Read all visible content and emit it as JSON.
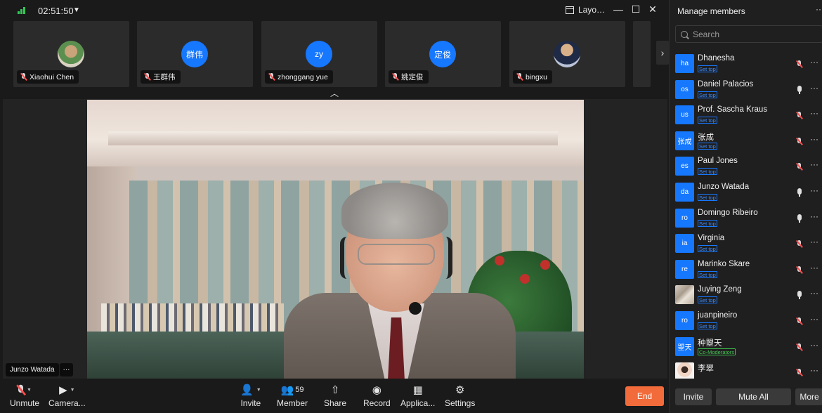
{
  "topbar": {
    "timer": "02:51:50",
    "layout_label": "Layo…",
    "colors": {
      "signal": "#35c759"
    }
  },
  "thumbnails": [
    {
      "name": "Xiaohui Chen",
      "avatar_text": "",
      "avatar_kind": "photo"
    },
    {
      "name": "王群伟",
      "avatar_text": "群伟",
      "avatar_kind": "initials"
    },
    {
      "name": "zhonggang yue",
      "avatar_text": "zy",
      "avatar_kind": "initials"
    },
    {
      "name": "姚定俊",
      "avatar_text": "定俊",
      "avatar_kind": "initials"
    },
    {
      "name": "bingxu",
      "avatar_text": "",
      "avatar_kind": "photo"
    }
  ],
  "main_video": {
    "speaker_name": "Junzo Watada",
    "more_label": "···"
  },
  "toolbar": {
    "unmute_label": "Unmute",
    "camera_label": "Camera...",
    "invite_label": "Invite",
    "member_label": "Member",
    "member_count": "59",
    "share_label": "Share",
    "record_label": "Record",
    "apps_label": "Applica...",
    "settings_label": "Settings",
    "end_label": "End",
    "colors": {
      "end": "#f26b3a"
    }
  },
  "panel": {
    "title": "Manage members",
    "search_placeholder": "Search",
    "members": [
      {
        "avatar": "ha",
        "name": "Dhanesha",
        "sub": "Set top",
        "mic": "muted"
      },
      {
        "avatar": "os",
        "name": "Daniel Palacios",
        "sub": "Set top",
        "mic": "on"
      },
      {
        "avatar": "us",
        "name": "Prof. Sascha Kraus",
        "sub": "Set top",
        "mic": "muted"
      },
      {
        "avatar": "张成",
        "name": "张成",
        "sub": "Set top",
        "mic": "muted"
      },
      {
        "avatar": "es",
        "name": "Paul Jones",
        "sub": "Set top",
        "mic": "muted"
      },
      {
        "avatar": "da",
        "name": "Junzo Watada",
        "sub": "Set top",
        "mic": "on"
      },
      {
        "avatar": "ro",
        "name": "Domingo Ribeiro",
        "sub": "Set top",
        "mic": "on"
      },
      {
        "avatar": "ia",
        "name": "Virginia",
        "sub": "Set top",
        "mic": "muted"
      },
      {
        "avatar": "re",
        "name": "Marinko Skare",
        "sub": "Set top",
        "mic": "muted"
      },
      {
        "avatar": "",
        "name": "Juying Zeng",
        "sub": "Set top",
        "mic": "on"
      },
      {
        "avatar": "ro",
        "name": "juanpineiro",
        "sub": "Set top",
        "mic": "muted"
      },
      {
        "avatar": "曌天",
        "name": "种曌天",
        "sub": "Co-Moderators",
        "mic": "muted"
      },
      {
        "avatar": "",
        "name": "李翠",
        "sub": "",
        "mic": "muted"
      }
    ],
    "footer": {
      "invite_label": "Invite",
      "mute_all_label": "Mute All",
      "more_label": "More"
    },
    "colors": {
      "avatar": "#1677ff",
      "set_top": "#1677ff",
      "co_moderator": "#3fbf4c"
    }
  }
}
